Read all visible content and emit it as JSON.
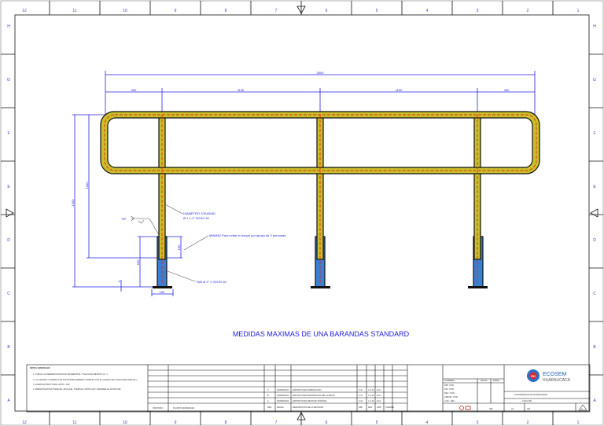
{
  "grid": {
    "columns": [
      "12",
      "11",
      "10",
      "9",
      "8",
      "7",
      "6",
      "5",
      "4",
      "3",
      "2",
      "1"
    ],
    "rows": [
      "H",
      "G",
      "F",
      "E",
      "D",
      "C",
      "B",
      "A"
    ]
  },
  "dimensions": {
    "total_length": "3000",
    "end_left": "400",
    "span_1": "1100",
    "span_2": "1100",
    "end_right": "400",
    "total_height": "1200",
    "rail_height": "1000",
    "embed_depth": "550",
    "sleeve_overlap": "150",
    "base_offset": "0",
    "base_width": "150"
  },
  "annotations": {
    "tip": "TIP.",
    "diameter_line1": "DIAMETRO STANDAD",
    "diameter_line2": "Ø 1 1-2\" SCHD 40",
    "minimum": "MINIMO Para evitar el torque por apoyo de 2 personas",
    "sleeve": "TUB Ø 2\" X  SCHD 40"
  },
  "drawing_title": "MEDIDAS MAXIMAS DE UNA BARANDAS STANDARD",
  "title_block": {
    "notes_title": "NOTAS GENERALES",
    "notes": [
      "1. TODAS LAS MEDIDAS ESTAN EN MILIMETROS Y SALVO EN METROS (S. I.)",
      "2. LA CALIDAD Y TRABAJO DE SOLDADURA DEBERA CUMPLIR CON EL CODIGO DE SOLDADURA AWS D1.1",
      "3. ACERO ESTRUCTURAL ASTM - A36",
      "4. PERNOS ESTRUCTURALES, ANCLAJE, TUERCAS, ASTM A-36 Y ARANDELAS ASTM F436"
    ],
    "ref_label": "NRO/NOM.",
    "ref_value": "PLANOS GENERALES",
    "revisions": [
      {
        "rev": "C",
        "date": "DD/MM/2022",
        "desc": "EMITIDO PARA FABRICACION",
        "by": "C.M.",
        "chk": "L.G.M.",
        "app": "E.M."
      },
      {
        "rev": "B",
        "date": "DD/MM/2022",
        "desc": "EMITIDO PARA APROBACION DEL CLIENTE",
        "by": "C.M.",
        "chk": "L.G.M.",
        "app": "E.M."
      },
      {
        "rev": "A",
        "date": "DD/MM/2022",
        "desc": "EMITIDO PARA REVISION INTERNA",
        "by": "C.M.",
        "chk": "L.G.M.",
        "app": "E.M."
      }
    ],
    "rev_headers": [
      "REV.",
      "FECHA",
      "DESCRIPCION DE LA REVISION",
      "DIB.",
      "REV.",
      "APR.",
      "CLIENTE"
    ],
    "sign_headers": [
      "NOMBRES",
      "FECHA",
      "FIRMA"
    ],
    "sign_rows": [
      "DIB.: POR",
      "DIS.: POR",
      "REV.: POR",
      "APROB.: POR",
      "CLIE.: REV."
    ],
    "company_line1": "ECOSEM",
    "company_line2": "HUARAUCACA",
    "project_title": "STANDARIZACION DE BARANDAS",
    "drawing_number": "CASO 001",
    "units": "IND.",
    "sheet_size": "A4",
    "scale": "S/E",
    "rev_current": "A"
  }
}
